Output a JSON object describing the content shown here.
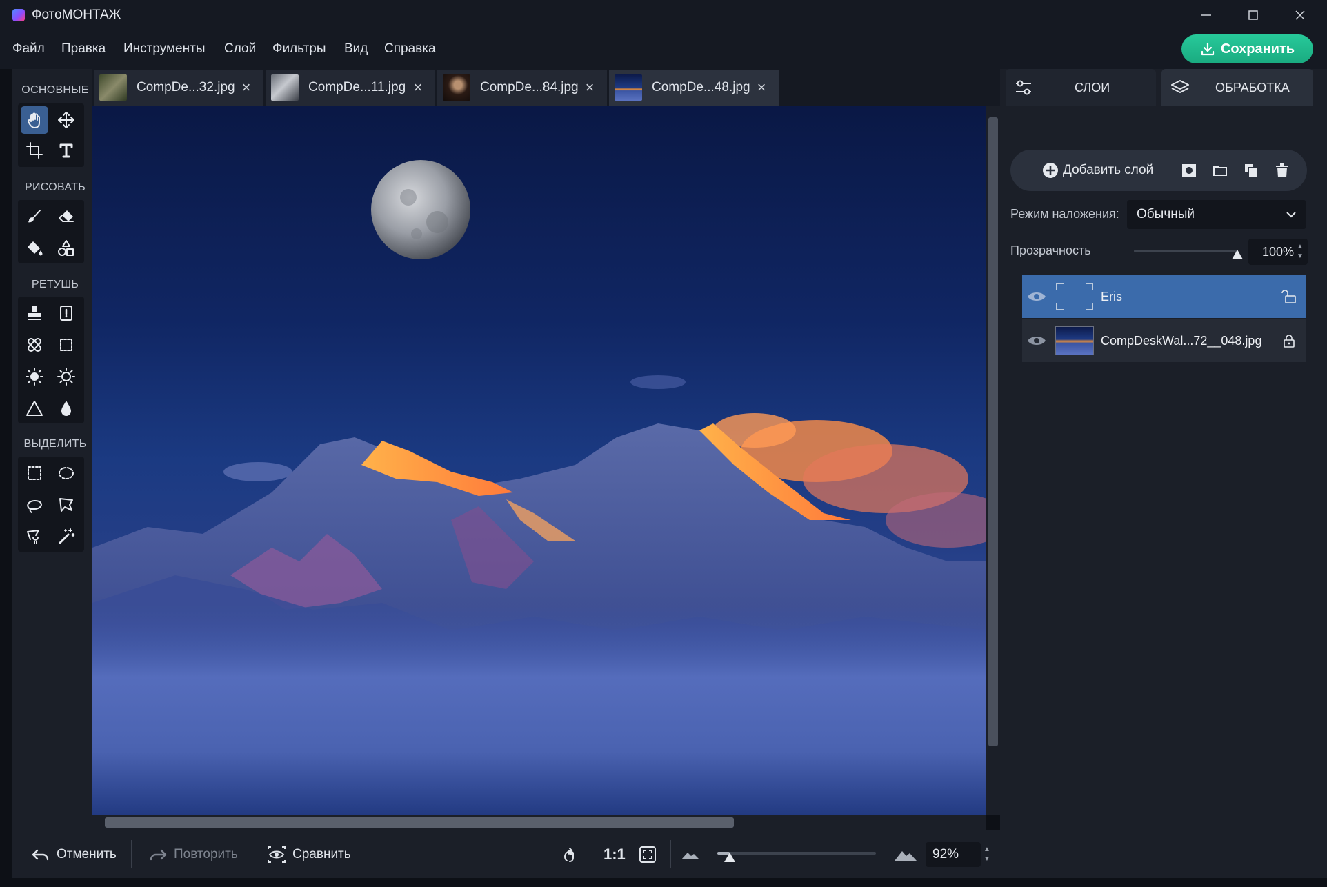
{
  "window": {
    "title": "ФотоМОНТАЖ"
  },
  "menu": {
    "items": [
      "Файл",
      "Правка",
      "Инструменты",
      "Слой",
      "Фильтры",
      "Вид",
      "Справка"
    ]
  },
  "save_button": {
    "label": "Сохранить"
  },
  "toolbox": {
    "sections": [
      "ОСНОВНЫЕ",
      "РИСОВАТЬ",
      "РЕТУШЬ",
      "ВЫДЕЛИТЬ"
    ]
  },
  "tabs": [
    {
      "label": "CompDe...32.jpg",
      "active": false
    },
    {
      "label": "CompDe...11.jpg",
      "active": false
    },
    {
      "label": "CompDe...84.jpg",
      "active": false
    },
    {
      "label": "CompDe...48.jpg",
      "active": true
    }
  ],
  "bottom_bar": {
    "undo": "Отменить",
    "redo": "Повторить",
    "compare": "Сравнить",
    "one_to_one": "1:1",
    "zoom_value": "92%",
    "zoom_level": 0.08
  },
  "right_panel": {
    "tabs": {
      "layers": "СЛОИ",
      "processing": "ОБРАБОТКА"
    },
    "add_layer": "Добавить слой",
    "blend_label": "Режим наложения:",
    "blend_value": "Обычный",
    "opacity_label": "Прозрачность",
    "opacity_value": "100%",
    "opacity_level": 1.0,
    "layers": [
      {
        "name": "Eris",
        "selected": true,
        "locked": false
      },
      {
        "name": "CompDeskWal...72__048.jpg",
        "selected": false,
        "locked": true
      }
    ]
  },
  "colors": {
    "accent": "#1fb98a",
    "selection": "#3b6bab",
    "panel": "#1b1f28"
  }
}
